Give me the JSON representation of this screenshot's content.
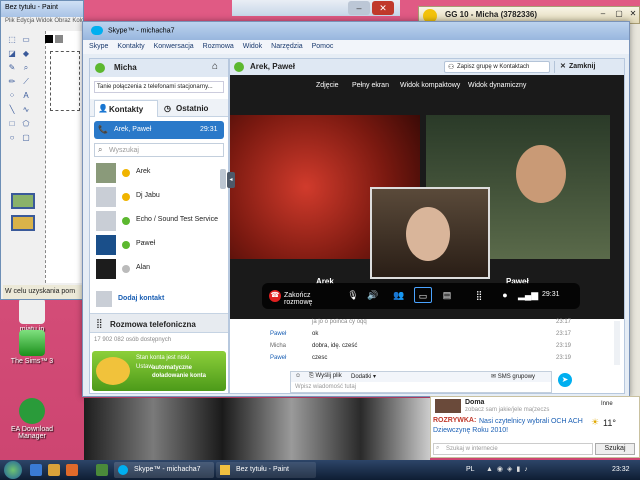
{
  "desktop": {
    "icons": [
      {
        "label": "miatu.jp"
      },
      {
        "label": "The Sims™ 3"
      },
      {
        "label": "EA Download Manager"
      }
    ]
  },
  "paint": {
    "title": "Bez tytułu - Paint",
    "menu": "Plik  Edycja  Widok  Obraz  Kolory  Pomoc",
    "status": "W celu uzyskania pom"
  },
  "gg": {
    "title": "GG 10 - Micha (3782336)",
    "contact": "Doma",
    "contact_sub": "zobacz sam jakie/jele ma(zeczs",
    "ad_title": "ROZRYWKA:",
    "ad_text": "Nasi czytelnicy wybrali OCH ACH Dziewczynę Roku 2010!",
    "weather": "11°",
    "search_placeholder": "Szukaj w internecie",
    "search_button": "Szukaj",
    "extra": "Inne"
  },
  "skype": {
    "window_title": "Skype™ - michacha7",
    "menu": [
      "Skype",
      "Kontakty",
      "Konwersacja",
      "Rozmowa",
      "Widok",
      "Narzędzia",
      "Pomoc"
    ],
    "user": {
      "name": "Micha",
      "mood": "Tanie połączenia z telefonami stacjonarny..."
    },
    "tabs": {
      "contacts": "Kontakty",
      "recent": "Ostatnio"
    },
    "active_call": {
      "name": "Arek, Paweł",
      "time": "29:31"
    },
    "search_placeholder": "Wyszukaj",
    "contacts": [
      {
        "name": "Arek"
      },
      {
        "name": "Dj Jabu"
      },
      {
        "name": "Echo / Sound Test Service"
      },
      {
        "name": "Paweł"
      },
      {
        "name": "Alan"
      }
    ],
    "add_contact": "Dodaj kontakt",
    "phone_section": "Rozmowa telefoniczna",
    "online_count": "17 902 082 osób dostępnych",
    "promo_line1": "Stan konta jest niski.",
    "promo_line2": "Ustaw",
    "promo_bold": "automatyczne doładowanie konta",
    "conversation": {
      "title": "Arek, Paweł",
      "save_group": "Zapisz grupę w Kontaktach",
      "close": "Zamknij"
    },
    "video_buttons": [
      "Zdjęcie",
      "Pełny ekran",
      "Widok kompaktowy",
      "Widok dynamiczny"
    ],
    "participants": [
      "Arek",
      "Paweł"
    ],
    "call_controls": {
      "end_call": "Zakończ rozmowę",
      "time": "29:31"
    },
    "chat": [
      {
        "name": "",
        "text": "ja jo o poinca cy oqq",
        "time": "23:17"
      },
      {
        "name": "Paweł",
        "text": "ok",
        "time": "23:17"
      },
      {
        "name": "Micha",
        "text": "dobra, idę. cześć",
        "time": "23:19"
      },
      {
        "name": "Paweł",
        "text": "czesc",
        "time": "23:19"
      }
    ],
    "composer": {
      "send_file": "Wyślij plik",
      "add": "Dodatki",
      "sms": "SMS grupowy",
      "placeholder": "Wpisz wiadomość tutaj"
    }
  },
  "taskbar": {
    "items": [
      "Skype™ - michacha7",
      "Bez tytułu - Paint"
    ],
    "lang": "PL",
    "clock": "23:32"
  }
}
